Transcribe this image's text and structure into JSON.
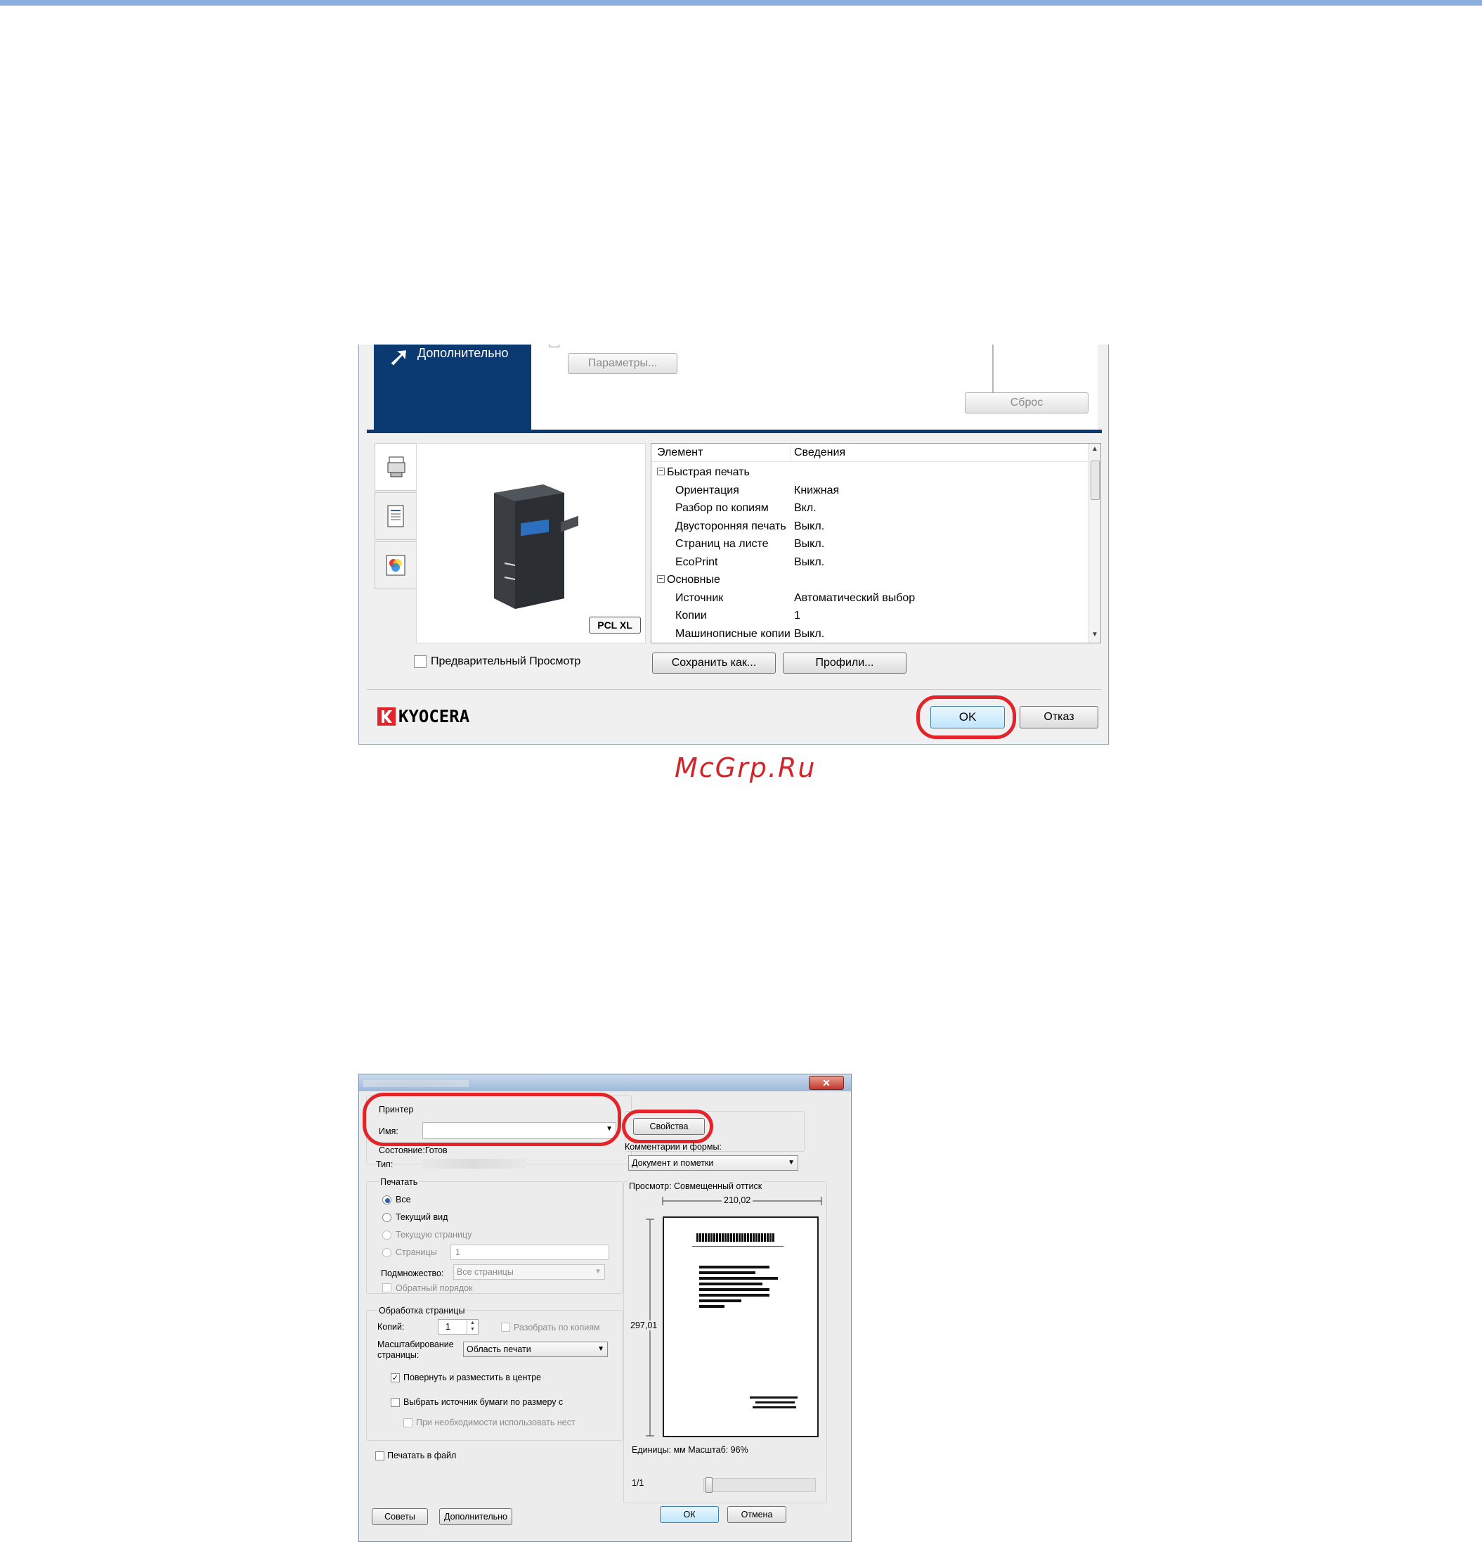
{
  "driver_dialog": {
    "sidebar_label": "Дополнительно",
    "params_button": "Параметры...",
    "reset_button": "Сброс",
    "preview_model_label": "PCL XL",
    "tree": {
      "col_item": "Элемент",
      "col_details": "Сведения",
      "rows": [
        {
          "name": "Быстрая печать",
          "value": "",
          "group": true
        },
        {
          "name": "Ориентация",
          "value": "Книжная",
          "group": false
        },
        {
          "name": "Разбор по копиям",
          "value": "Вкл.",
          "group": false
        },
        {
          "name": "Двусторонняя печать",
          "value": "Выкл.",
          "group": false
        },
        {
          "name": "Страниц на листе",
          "value": "Выкл.",
          "group": false
        },
        {
          "name": "EcoPrint",
          "value": "Выкл.",
          "group": false
        },
        {
          "name": "Основные",
          "value": "",
          "group": true
        },
        {
          "name": "Источник",
          "value": "Автоматический выбор",
          "group": false
        },
        {
          "name": "Копии",
          "value": "1",
          "group": false
        },
        {
          "name": "Машинописные копии",
          "value": "Выкл.",
          "group": false
        }
      ]
    },
    "preview_checkbox_label": "Предварительный Просмотр",
    "save_as_button": "Сохранить как...",
    "profiles_button": "Профили...",
    "brand": "KYOCERA",
    "ok_button": "OK",
    "cancel_button": "Отказ"
  },
  "watermark": "McGrp.Ru",
  "print_dialog": {
    "printer_group": "Принтер",
    "name_label": "Имя:",
    "properties_button": "Свойства",
    "status_label": "Состояние:Готов",
    "type_label": "Тип:",
    "comments_label": "Комментарии и формы:",
    "comments_value": "Документ и пометки",
    "print_group": "Печатать",
    "radio_all": "Все",
    "radio_current_view": "Текущий вид",
    "radio_current_page": "Текущую страницу",
    "radio_pages": "Страницы",
    "pages_value": "1",
    "subset_label": "Подмножество:",
    "subset_value": "Все страницы",
    "reverse_order": "Обратный порядок",
    "page_handling_group": "Обработка страницы",
    "copies_label": "Копий:",
    "copies_value": "1",
    "collate_label": "Разобрать по копиям",
    "scaling_label": "Масштабирование страницы:",
    "scaling_value": "Область печати",
    "auto_rotate": "Повернуть и разместить в центре",
    "choose_source": "Выбрать источник бумаги по размеру с",
    "use_pdf_page_size": "При необходимости использовать нест",
    "print_to_file": "Печатать в файл",
    "preview_label": "Просмотр: Совмещенный оттиск",
    "width_dim": "210,02",
    "height_dim": "297,01",
    "units_label": "Единицы: мм Масштаб:  96%",
    "page_counter": "1/1",
    "tips_button": "Советы",
    "advanced_button": "Дополнительно",
    "ok_button": "ОК",
    "cancel_button": "Отмена"
  }
}
